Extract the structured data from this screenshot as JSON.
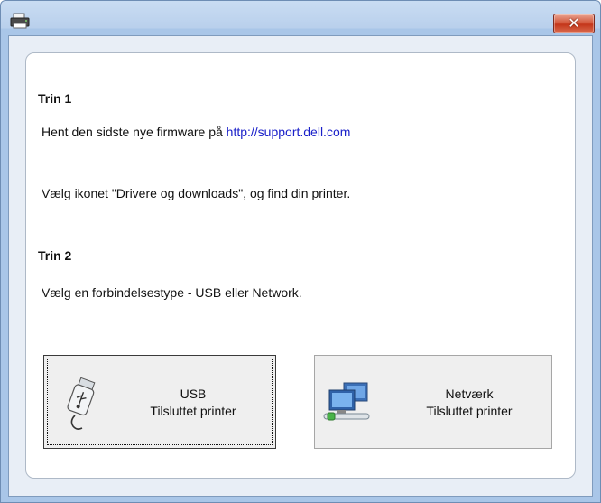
{
  "window": {
    "close_glyph": "✕"
  },
  "step1": {
    "heading": "Trin 1",
    "line1_prefix": "Hent den sidste nye firmware på ",
    "line1_link": "http://support.dell.com",
    "line2": "Vælg ikonet \"Drivere og downloads\", og find din printer."
  },
  "step2": {
    "heading": "Trin 2",
    "line": "Vælg en forbindelsestype - USB eller Network."
  },
  "usb_button": {
    "title": "USB",
    "subtitle": "Tilsluttet printer",
    "icon": "usb-drive-icon"
  },
  "network_button": {
    "title": "Netværk",
    "subtitle": "Tilsluttet printer",
    "icon": "network-computers-icon"
  },
  "colors": {
    "link": "#1a20c9",
    "close": "#c4361a",
    "frame": "#a9c6e8"
  }
}
